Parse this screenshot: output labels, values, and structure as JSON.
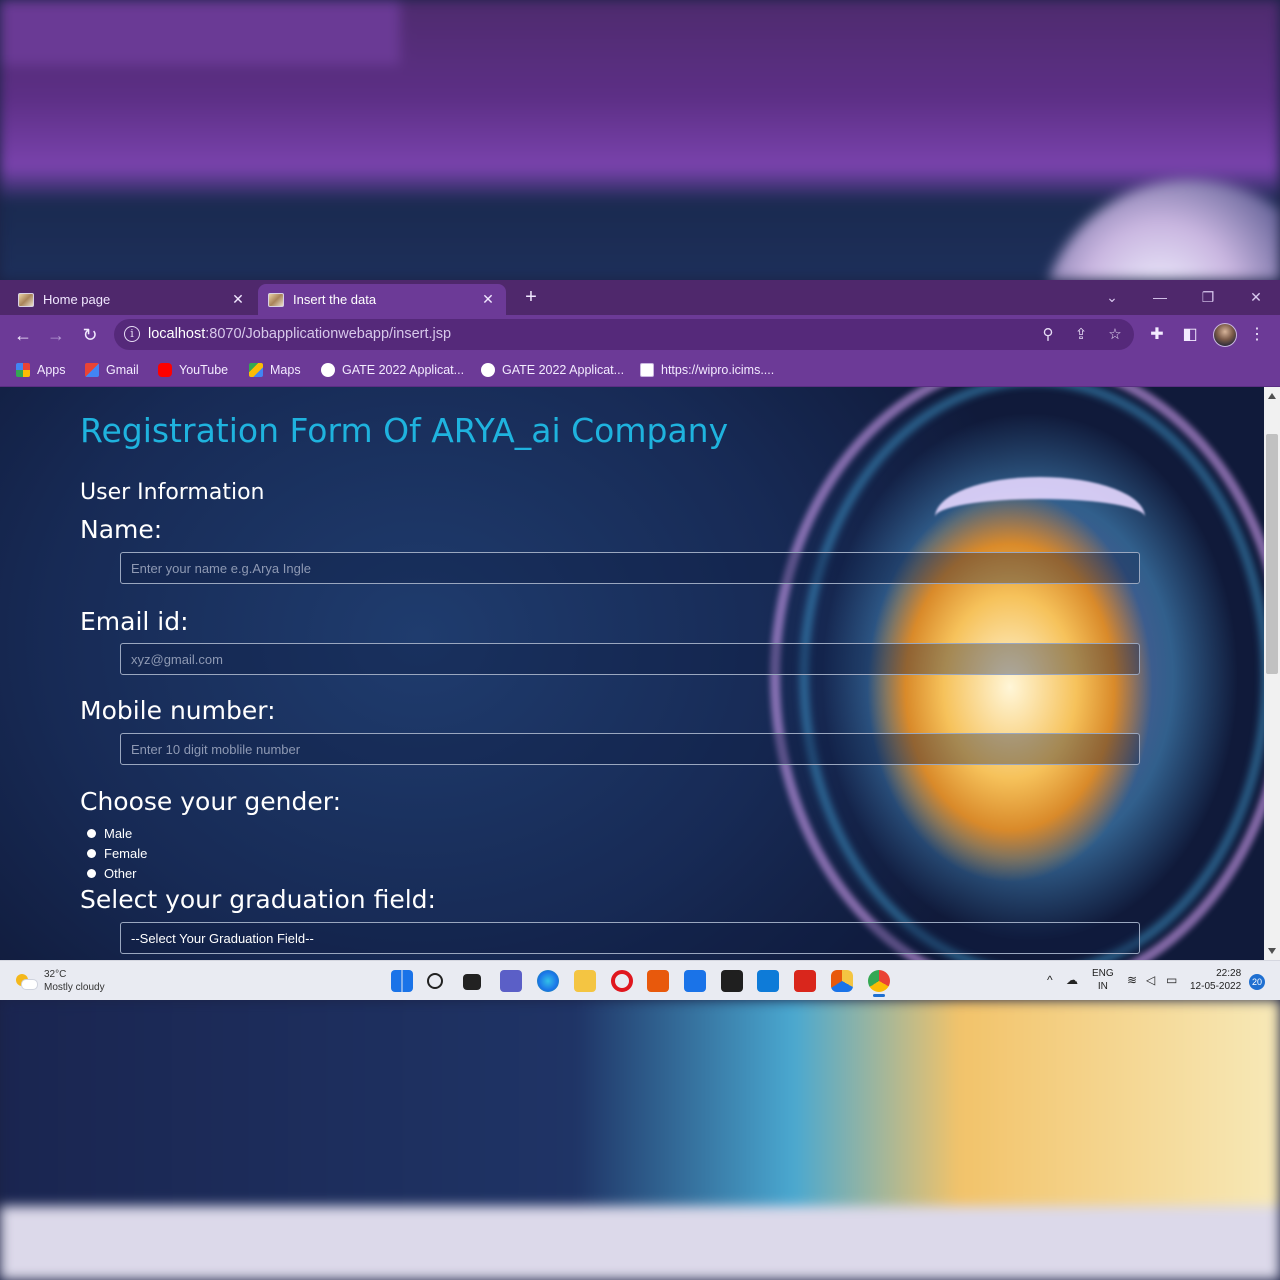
{
  "browser": {
    "tabs": [
      {
        "label": "Home page",
        "active": false
      },
      {
        "label": "Insert the data",
        "active": true
      }
    ],
    "url_host": "localhost",
    "url_rest": ":8070/Jobapplicationwebapp/insert.jsp",
    "bookmarks": [
      {
        "label": "Apps",
        "icon": "apps-grid-icon"
      },
      {
        "label": "Gmail",
        "icon": "gmail-icon"
      },
      {
        "label": "YouTube",
        "icon": "youtube-icon"
      },
      {
        "label": "Maps",
        "icon": "maps-icon"
      },
      {
        "label": "GATE 2022 Applicat...",
        "icon": "globe-icon"
      },
      {
        "label": "GATE 2022 Applicat...",
        "icon": "globe-icon"
      },
      {
        "label": "https://wipro.icims....",
        "icon": "page-icon"
      }
    ],
    "colors": {
      "tabstrip": "#4f286c",
      "toolbar": "#6c3a97",
      "omnibox": "#55297a"
    }
  },
  "page": {
    "title": "Registration Form Of ARYA_ai Company",
    "section": "User Information",
    "name_label": "Name:",
    "name_placeholder": "Enter your name e.g.Arya Ingle",
    "email_label": "Email id:",
    "email_placeholder": "xyz@gmail.com",
    "mobile_label": "Mobile number:",
    "mobile_placeholder": "Enter 10 digit moblile number",
    "gender_label": "Choose your gender:",
    "gender_options": [
      "Male",
      "Female",
      "Other"
    ],
    "grad_label": "Select your graduation field:",
    "grad_selected": "--Select Your Graduation Field--",
    "colors": {
      "title": "#1fb3de",
      "label": "#ffffff"
    }
  },
  "taskbar": {
    "weather_temp": "32°C",
    "weather_desc": "Mostly cloudy",
    "lang_top": "ENG",
    "lang_bottom": "IN",
    "time": "22:28",
    "date": "12-05-2022",
    "notifications": "20"
  }
}
